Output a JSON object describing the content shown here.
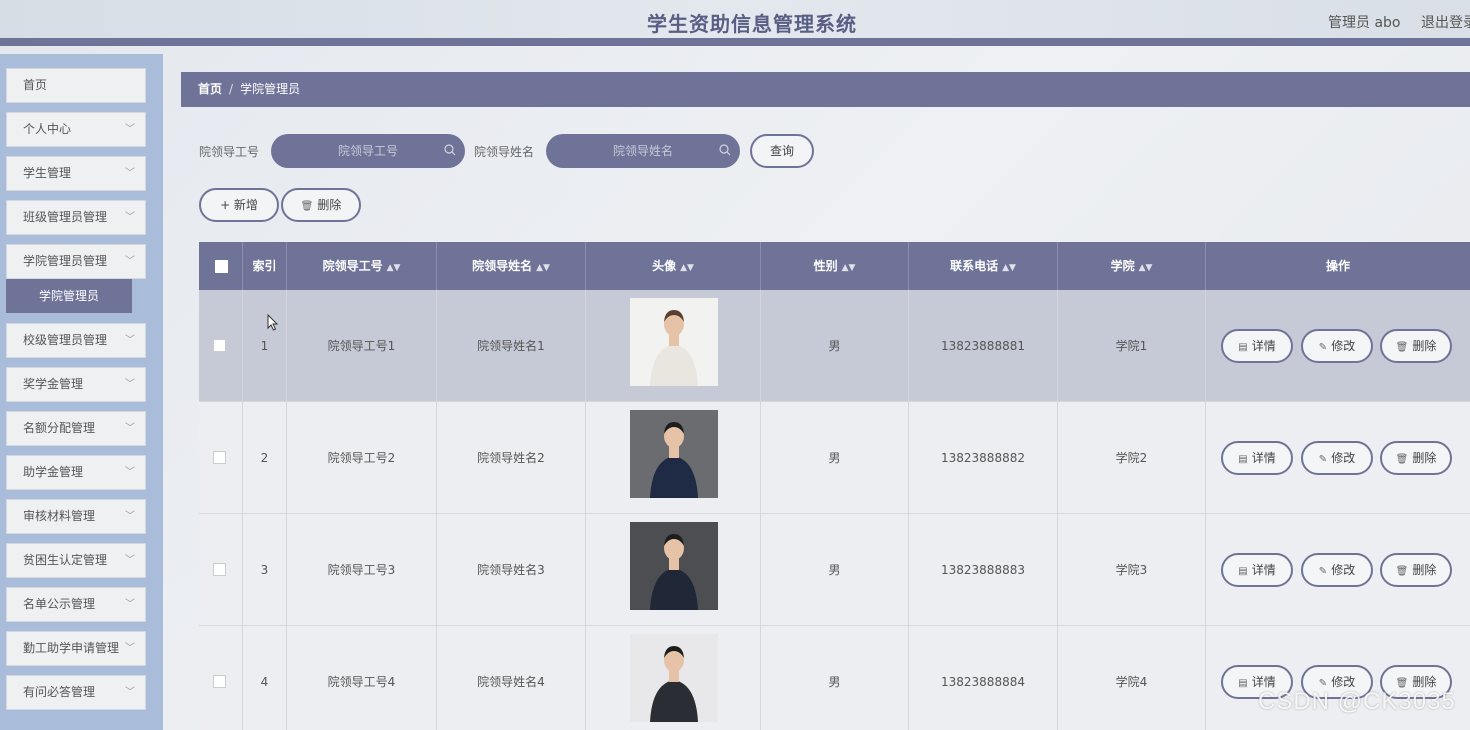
{
  "header": {
    "title": "学生资助信息管理系统",
    "user": "管理员 abo",
    "logout": "退出登录"
  },
  "sidebar": {
    "items": [
      {
        "label": "首页",
        "chevron": false
      },
      {
        "label": "个人中心",
        "chevron": true
      },
      {
        "label": "学生管理",
        "chevron": true
      },
      {
        "label": "班级管理员管理",
        "chevron": true
      },
      {
        "label": "学院管理员管理",
        "chevron": true
      },
      {
        "label": "校级管理员管理",
        "chevron": true
      },
      {
        "label": "奖学金管理",
        "chevron": true
      },
      {
        "label": "名额分配管理",
        "chevron": true
      },
      {
        "label": "助学金管理",
        "chevron": true
      },
      {
        "label": "审核材料管理",
        "chevron": true
      },
      {
        "label": "贫困生认定管理",
        "chevron": true
      },
      {
        "label": "名单公示管理",
        "chevron": true
      },
      {
        "label": "勤工助学申请管理",
        "chevron": true
      },
      {
        "label": "有问必答管理",
        "chevron": true
      }
    ],
    "active_sub": "学院管理员"
  },
  "breadcrumb": {
    "home": "首页",
    "sep": "/",
    "current": "学院管理员"
  },
  "search": {
    "field1_label": "院领导工号",
    "field1_placeholder": "院领导工号",
    "field2_label": "院领导姓名",
    "field2_placeholder": "院领导姓名",
    "query_label": "查询"
  },
  "toolbar": {
    "add_label": "+ 新增",
    "delete_label": "删除"
  },
  "table": {
    "headers": [
      "索引",
      "院领导工号",
      "院领导姓名",
      "头像",
      "性别",
      "联系电话",
      "学院",
      "操作"
    ],
    "rows": [
      {
        "index": "1",
        "job_no": "院领导工号1",
        "name": "院领导姓名1",
        "gender": "男",
        "phone": "13823888881",
        "college": "学院1"
      },
      {
        "index": "2",
        "job_no": "院领导工号2",
        "name": "院领导姓名2",
        "gender": "男",
        "phone": "13823888882",
        "college": "学院2"
      },
      {
        "index": "3",
        "job_no": "院领导工号3",
        "name": "院领导姓名3",
        "gender": "男",
        "phone": "13823888883",
        "college": "学院3"
      },
      {
        "index": "4",
        "job_no": "院领导工号4",
        "name": "院领导姓名4",
        "gender": "男",
        "phone": "13823888884",
        "college": "学院4"
      }
    ],
    "actions": {
      "detail": "详情",
      "edit": "修改",
      "delete": "删除"
    }
  },
  "watermark": "CSDN @CK3035",
  "colors": {
    "accent": "#6e7397",
    "sidebar_bg": "#a9bcd9",
    "title": "#595e84"
  }
}
